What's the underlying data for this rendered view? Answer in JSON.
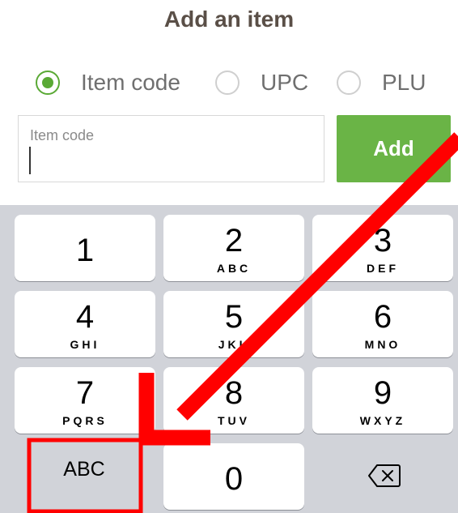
{
  "title": "Add an item",
  "radio_options": [
    {
      "label": "Item code",
      "selected": true
    },
    {
      "label": "UPC",
      "selected": false
    },
    {
      "label": "PLU",
      "selected": false
    }
  ],
  "input": {
    "placeholder": "Item code",
    "value": ""
  },
  "add_button": "Add",
  "keypad": {
    "keys": [
      {
        "num": "1",
        "letters": ""
      },
      {
        "num": "2",
        "letters": "ABC"
      },
      {
        "num": "3",
        "letters": "DEF"
      },
      {
        "num": "4",
        "letters": "GHI"
      },
      {
        "num": "5",
        "letters": "JKL"
      },
      {
        "num": "6",
        "letters": "MNO"
      },
      {
        "num": "7",
        "letters": "PQRS"
      },
      {
        "num": "8",
        "letters": "TUV"
      },
      {
        "num": "9",
        "letters": "WXYZ"
      },
      {
        "num": "0",
        "letters": ""
      }
    ],
    "abc_label": "ABC",
    "delete_icon": "backspace-icon"
  },
  "colors": {
    "accent_green": "#6ab446",
    "radio_green": "#5aa935",
    "annotation_red": "#ff0000",
    "keypad_bg": "#d1d3d9"
  }
}
